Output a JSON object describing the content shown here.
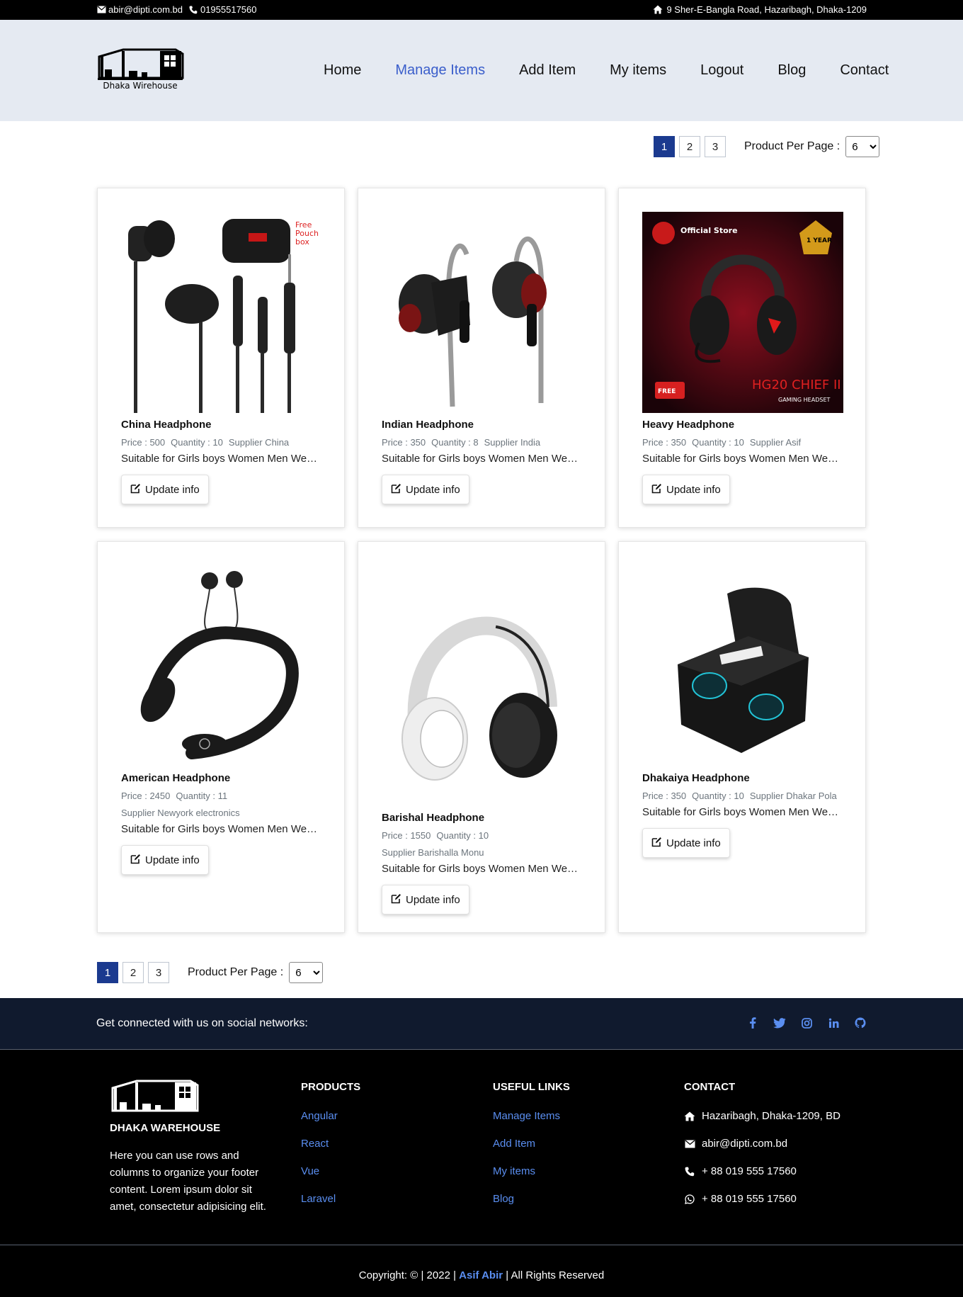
{
  "topbar": {
    "email": "abir@dipti.com.bd",
    "phone": "01955517560",
    "address": "9 Sher-E-Bangla Road, Hazaribagh, Dhaka-1209",
    "icons": [
      "envelope-icon",
      "phone-icon",
      "home-icon"
    ]
  },
  "header": {
    "logo_text": "Dhaka Wirehouse",
    "nav": [
      {
        "label": "Home"
      },
      {
        "label": "Manage Items",
        "active": true
      },
      {
        "label": "Add Item"
      },
      {
        "label": "My items"
      },
      {
        "label": "Logout"
      },
      {
        "label": "Blog"
      },
      {
        "label": "Contact"
      }
    ]
  },
  "pagination": {
    "pages": [
      "1",
      "2",
      "3"
    ],
    "current": "1",
    "per_page_label": "Product Per Page :",
    "per_page_value": "6"
  },
  "products": [
    {
      "name": "China Headphone",
      "price": "Price : 500",
      "quantity": "Quantity : 10",
      "supplier": "Supplier China",
      "description": "Suitable for Girls boys Women Men Wearin...",
      "button": "Update info",
      "image": "wired-earphones-with-pouch"
    },
    {
      "name": "Indian Headphone",
      "price": "Price : 350",
      "quantity": "Quantity : 8",
      "supplier": "Supplier India",
      "description": "Suitable for Girls boys Women Men Wearin...",
      "button": "Update info",
      "image": "ear-hook-earphones"
    },
    {
      "name": "Heavy Headphone",
      "price": "Price : 350",
      "quantity": "Quantity : 10",
      "supplier": "Supplier Asif",
      "description": "Suitable for Girls boys Women Men Wearin...",
      "button": "Update info",
      "image": "gaming-headset-red",
      "image_text": {
        "store": "Official Store",
        "year": "1 YEAR",
        "model": "HG20 CHIEF II",
        "sub": "GAMING HEADSET",
        "free": "FREE"
      }
    },
    {
      "name": "American Headphone",
      "price": "Price : 2450",
      "quantity": "Quantity : 11",
      "supplier": "Supplier Newyork electronics",
      "description": "Suitable for Girls boys Women Men Wearin...",
      "button": "Update info",
      "image": "neckband-earphones"
    },
    {
      "name": "Barishal Headphone",
      "price": "Price : 1550",
      "quantity": "Quantity : 10",
      "supplier": "Supplier Barishalla Monu",
      "description": "Suitable for Girls boys Women Men Wearin...",
      "button": "Update info",
      "image": "white-wireless-headphones"
    },
    {
      "name": "Dhakaiya Headphone",
      "price": "Price : 350",
      "quantity": "Quantity : 10",
      "supplier": "Supplier Dhakar Pola",
      "description": "Suitable for Girls boys Women Men Wearin...",
      "button": "Update info",
      "image": "wireless-earbuds-case"
    }
  ],
  "social": {
    "text": "Get connected with us on social networks:",
    "icons": [
      "facebook-icon",
      "twitter-icon",
      "instagram-icon",
      "linkedin-icon",
      "github-icon"
    ]
  },
  "footer": {
    "brand": "DHAKA WAREHOUSE",
    "about": "Here you can use rows and columns to organize your footer content. Lorem ipsum dolor sit amet, consectetur adipisicing elit.",
    "products_heading": "PRODUCTS",
    "products": [
      "Angular",
      "React",
      "Vue",
      "Laravel"
    ],
    "links_heading": "USEFUL LINKS",
    "links": [
      "Manage Items",
      "Add Item",
      "My items",
      "Blog"
    ],
    "contact_heading": "CONTACT",
    "contact": {
      "address": "Hazaribagh, Dhaka-1209, BD",
      "email": "abir@dipti.com.bd",
      "phone": "+ 88 019 555 17560",
      "whatsapp": "+ 88 019 555 17560"
    },
    "copyright_pre": "Copyright: © | 2022 |",
    "copyright_name": "Asif Abir",
    "copyright_post": "| All Rights Reserved"
  },
  "colors": {
    "accent": "#5a8ef0",
    "nav_active": "#3a5ecb",
    "pager_active": "#1b3a8f",
    "header_bg": "#e5eaf2",
    "social_bg": "#101a2e"
  }
}
